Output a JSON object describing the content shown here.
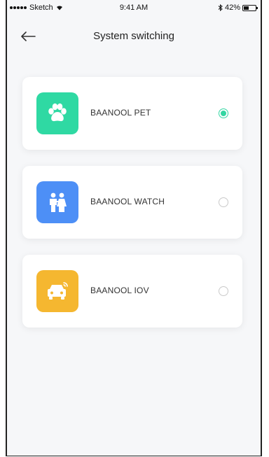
{
  "status_bar": {
    "carrier": "Sketch",
    "time": "9:41 AM",
    "battery_percent": "42%",
    "battery_level": 0.42
  },
  "nav": {
    "title": "System switching",
    "back_icon": "arrow-left-icon"
  },
  "systems": [
    {
      "label": "BAANOOL PET",
      "icon": "paw-icon",
      "color": "#2fd9a3",
      "selected": true
    },
    {
      "label": "BAANOOL WATCH",
      "icon": "family-icon",
      "color": "#4d8ff6",
      "selected": false
    },
    {
      "label": "BAANOOL IOV",
      "icon": "car-icon",
      "color": "#f5b730",
      "selected": false
    }
  ],
  "colors": {
    "accent": "#33d6a2",
    "background": "#f6f7f9"
  }
}
